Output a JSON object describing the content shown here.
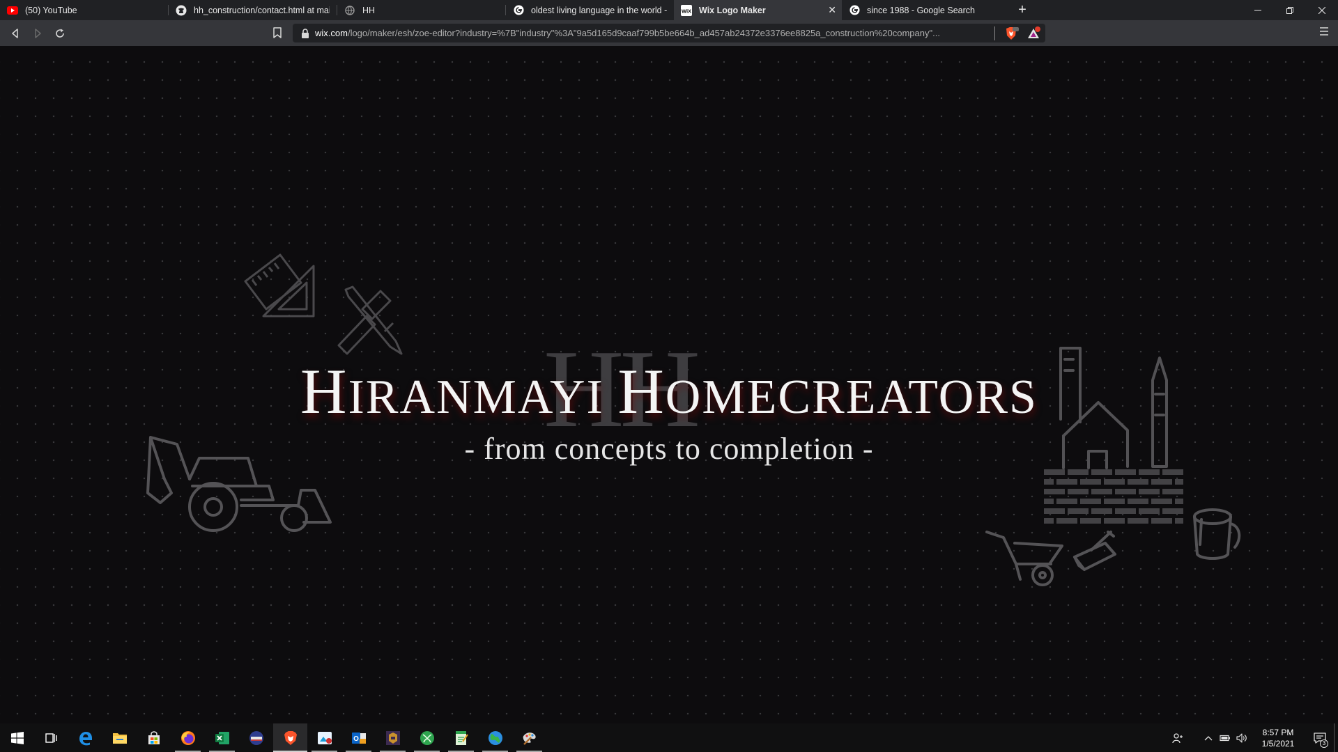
{
  "browser": {
    "tabs": [
      {
        "title": "(50) YouTube",
        "icon": "youtube-icon",
        "active": false
      },
      {
        "title": "hh_construction/contact.html at main",
        "icon": "github-icon",
        "active": false
      },
      {
        "title": "HH",
        "icon": "globe-icon",
        "active": false
      },
      {
        "title": "oldest living language in the world - G",
        "icon": "google-icon",
        "active": false
      },
      {
        "title": "Wix Logo Maker",
        "icon": "wix-icon",
        "active": true
      },
      {
        "title": "since 1988 - Google Search",
        "icon": "google-icon",
        "active": false
      }
    ],
    "address": {
      "host": "wix.com",
      "path": "/logo/maker/esh/zoe-editor?industry=%7B\"industry\"%3A\"9a5d165d9caaf799b5be664b_ad457ab24372e3376ee8825a_construction%20company\"..."
    }
  },
  "logo": {
    "monogram": "HH",
    "brand_parts": [
      {
        "big": "H",
        "small": "IRANMAYI "
      },
      {
        "big": "H",
        "small": "OMECREATORS"
      }
    ],
    "tagline": "- from concepts to completion -"
  },
  "taskbar": {
    "apps": [
      "start-icon",
      "task-view-icon",
      "edge-icon",
      "file-explorer-icon",
      "store-icon",
      "firefox-icon",
      "excel-icon",
      "app-icon",
      "brave-icon",
      "photos-icon",
      "outlook-icon",
      "game-icon",
      "xbox-icon",
      "notepad-icon",
      "globe-app-icon",
      "paint-icon"
    ],
    "clock_time": "8:57 PM",
    "clock_date": "1/5/2021",
    "notification_count": "3"
  },
  "colors": {
    "tab_bar": "#202124",
    "toolbar": "#35363a",
    "page_bg": "#0d0c0e",
    "brand_shadow": "#780a0a",
    "artwork": "#5a595c"
  }
}
